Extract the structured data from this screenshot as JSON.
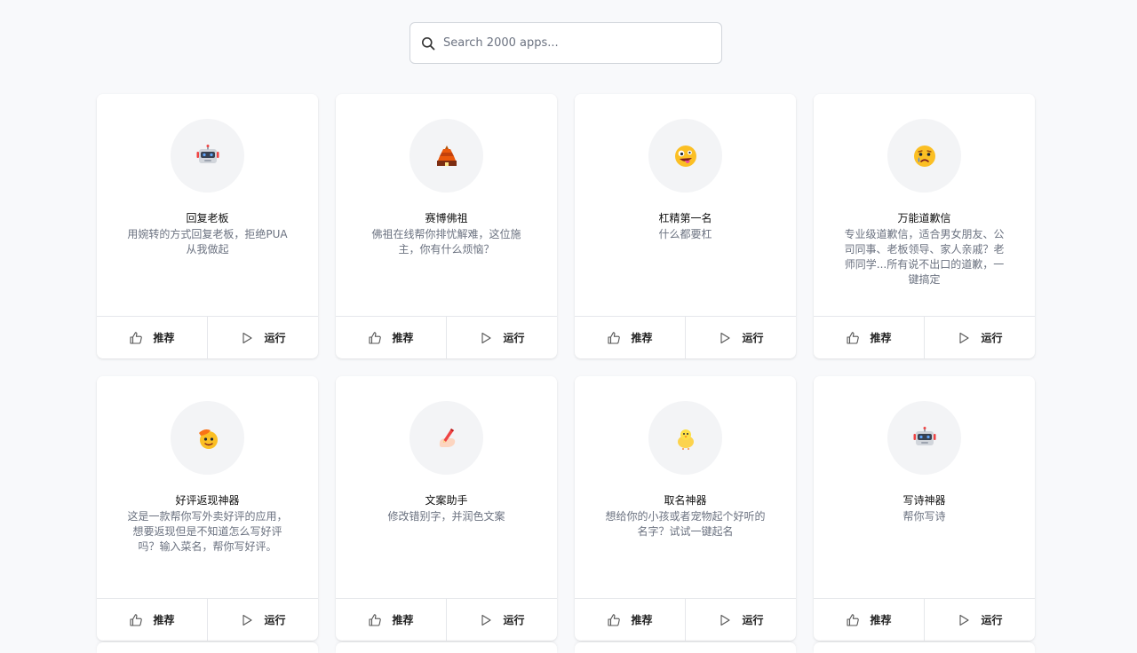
{
  "search": {
    "placeholder": "Search 2000 apps..."
  },
  "apps": [
    {
      "icon": "robot-icon",
      "title": "回复老板",
      "desc": "用婉转的方式回复老板，拒绝PUA从我做起"
    },
    {
      "icon": "pagoda-icon",
      "title": "赛博佛祖",
      "desc": "佛祖在线帮你排忧解难，这位施主，你有什么烦恼？"
    },
    {
      "icon": "zany-face-icon",
      "title": "杠精第一名",
      "desc": "什么都要杠"
    },
    {
      "icon": "crying-face-icon",
      "title": "万能道歉信",
      "desc": "专业级道歉信，适合男女朋友、公司同事、老板领导、家人亲戚？老师同学...所有说不出口的道歉，一键搞定"
    },
    {
      "icon": "cowboy-face-icon",
      "title": "好评返现神器",
      "desc": "这是一款帮你写外卖好评的应用，想要返现但是不知道怎么写好评吗？输入菜名，帮你写好评。"
    },
    {
      "icon": "writing-hand-icon",
      "title": "文案助手",
      "desc": "修改错别字，并润色文案"
    },
    {
      "icon": "chick-icon",
      "title": "取名神器",
      "desc": "想给你的小孩或者宠物起个好听的名字？试试一键起名"
    },
    {
      "icon": "robot-icon",
      "title": "写诗神器",
      "desc": "帮你写诗"
    }
  ],
  "card_actions": {
    "recommend_label": "推荐",
    "run_label": "运行"
  }
}
